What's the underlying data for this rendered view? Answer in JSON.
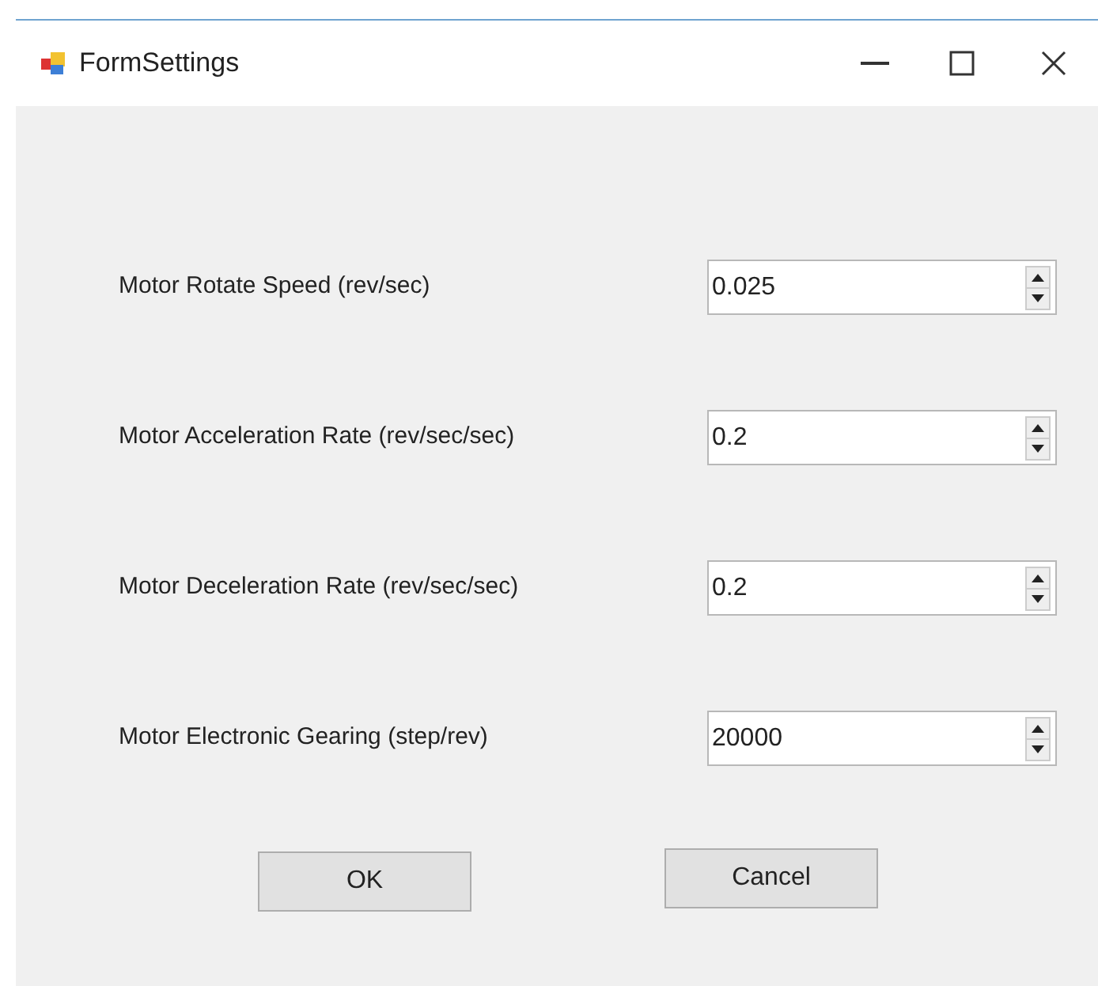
{
  "window": {
    "title": "FormSettings"
  },
  "settings": [
    {
      "label": "Motor Rotate Speed (rev/sec)",
      "value": "0.025"
    },
    {
      "label": "Motor Acceleration Rate (rev/sec/sec)",
      "value": "0.2"
    },
    {
      "label": "Motor Deceleration Rate (rev/sec/sec)",
      "value": "0.2"
    },
    {
      "label": "Motor Electronic Gearing (step/rev)",
      "value": "20000"
    }
  ],
  "buttons": [
    "OK",
    "Cancel"
  ]
}
